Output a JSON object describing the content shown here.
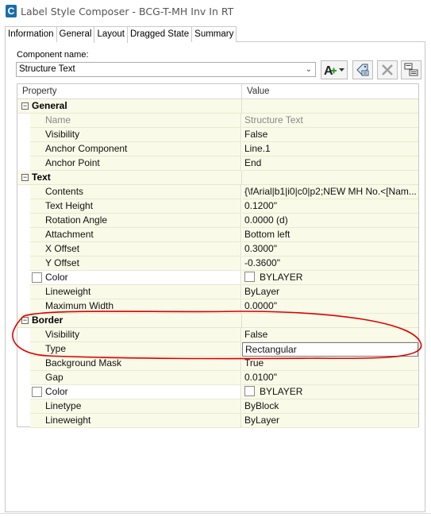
{
  "window": {
    "title": "Label Style Composer - BCG-T-MH Inv In RT",
    "app_icon": "C"
  },
  "tabs": [
    {
      "label": "Information",
      "active": false
    },
    {
      "label": "General",
      "active": false
    },
    {
      "label": "Layout",
      "active": true
    },
    {
      "label": "Dragged State",
      "active": false
    },
    {
      "label": "Summary",
      "active": false
    }
  ],
  "component": {
    "label": "Component name:",
    "value": "Structure Text"
  },
  "toolbar": {
    "add_icon": "add-component-icon",
    "copy_icon": "copy-component-icon",
    "delete_icon": "delete-component-icon",
    "order_icon": "component-draw-order-icon"
  },
  "grid": {
    "header_property": "Property",
    "header_value": "Value",
    "sections": [
      {
        "title": "General",
        "toggle": "−",
        "rows": [
          {
            "property": "Name",
            "value": "Structure Text",
            "grey": true
          },
          {
            "property": "Visibility",
            "value": "False"
          },
          {
            "property": "Anchor Component",
            "value": "Line.1"
          },
          {
            "property": "Anchor Point",
            "value": "End"
          }
        ]
      },
      {
        "title": "Text",
        "toggle": "−",
        "rows": [
          {
            "property": "Contents",
            "value": "{\\fArial|b1|i0|c0|p2;NEW MH No.<[Nam..."
          },
          {
            "property": "Text Height",
            "value": "0.1200\""
          },
          {
            "property": "Rotation Angle",
            "value": "0.0000 (d)"
          },
          {
            "property": "Attachment",
            "value": "Bottom left"
          },
          {
            "property": "X Offset",
            "value": "0.3000\""
          },
          {
            "property": "Y Offset",
            "value": "-0.3600\""
          },
          {
            "property": "Color",
            "value": "BYLAYER",
            "has_checkbox": true,
            "has_swatch": true
          },
          {
            "property": "Lineweight",
            "value": "ByLayer"
          },
          {
            "property": "Maximum Width",
            "value": "0.0000\""
          }
        ]
      },
      {
        "title": "Border",
        "toggle": "−",
        "rows": [
          {
            "property": "Visibility",
            "value": "False"
          },
          {
            "property": "Type",
            "value": "Rectangular",
            "selected": true
          },
          {
            "property": "Background Mask",
            "value": "True"
          },
          {
            "property": "Gap",
            "value": "0.0100\""
          },
          {
            "property": "Color",
            "value": "BYLAYER",
            "has_checkbox": true,
            "has_swatch": true
          },
          {
            "property": "Linetype",
            "value": "ByBlock"
          },
          {
            "property": "Lineweight",
            "value": "ByLayer"
          }
        ]
      }
    ]
  },
  "colors": {
    "row_bg": "#fafae8",
    "annotation_red": "#e00000",
    "app_icon_blue": "#1a6ea8"
  }
}
